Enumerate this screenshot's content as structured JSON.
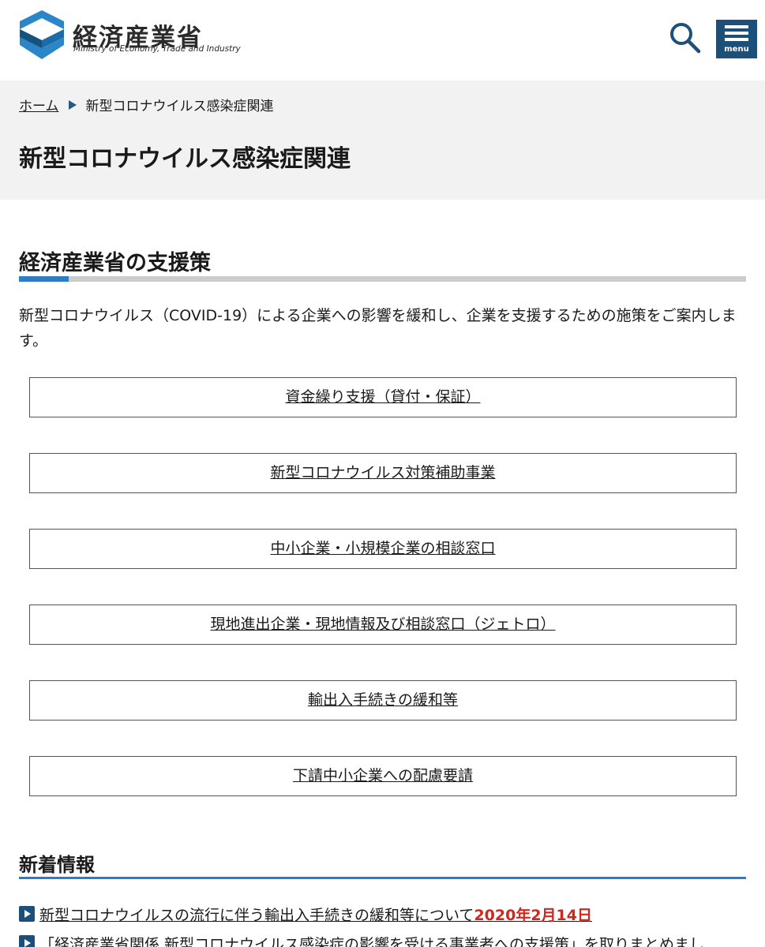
{
  "header": {
    "logo_jp": "経済産業省",
    "logo_en": "Ministry of Economy, Trade and Industry",
    "menu_label": "menu",
    "search_icon": "search-icon",
    "menu_icon": "hamburger-icon",
    "brand_color": "#1c4f79"
  },
  "breadcrumb": {
    "home": "ホーム",
    "current": "新型コロナウイルス感染症関連"
  },
  "page_title": "新型コロナウイルス感染症関連",
  "support": {
    "title": "経済産業省の支援策",
    "intro": "新型コロナウイルス（COVID-19）による企業への影響を緩和し、企業を支援するための施策をご案内します。",
    "links": [
      "資金繰り支援（貸付・保証）",
      "新型コロナウイルス対策補助事業",
      "中小企業・小規模企業の相談窓口",
      "現地進出企業・現地情報及び相談窓口（ジェトロ）",
      "輸出入手続きの緩和等",
      "下請中小企業への配慮要請"
    ]
  },
  "news": {
    "title": "新着情報",
    "items": [
      {
        "text": "新型コロナウイルスの流行に伴う輸出入手続きの緩和等について",
        "date": "2020年2月14日"
      },
      {
        "text": "「経済産業省関係 新型コロナウイルス感染症の影響を受ける事業者への支援策」を取りまとめまし",
        "date": ""
      }
    ],
    "date_color": "#d0261b"
  }
}
